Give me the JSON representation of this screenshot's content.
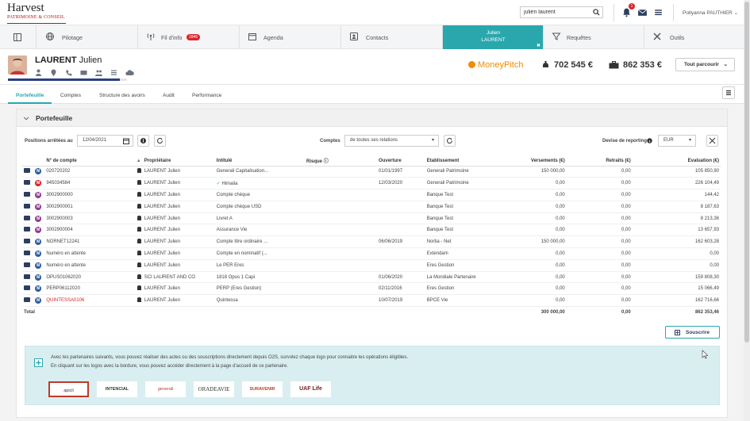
{
  "brand": {
    "line1": "Harvest",
    "line2": "PATRIMOINE & CONSEIL"
  },
  "search": {
    "value": "julien laurent"
  },
  "topbar": {
    "notif_count": "1",
    "user": "Pollyanna PAUTHIER"
  },
  "nav": {
    "items": [
      {
        "label": "Pilotage",
        "icon": "globe-icon"
      },
      {
        "label": "Fil d'info",
        "icon": "signal-icon",
        "badge": "1846"
      },
      {
        "label": "Agenda",
        "icon": "calendar-icon"
      },
      {
        "label": "Contacts",
        "icon": "contacts-icon"
      },
      {
        "label": "Julien",
        "label2": "LAURENT",
        "icon": "client-tab"
      },
      {
        "label": "Requêtes",
        "icon": "filter-icon"
      },
      {
        "label": "Outils",
        "icon": "tools-icon"
      }
    ]
  },
  "client": {
    "last": "LAURENT",
    "first": "Julien",
    "progress_pct": 94,
    "moneypitch": "MoneyPitch",
    "amount1": "702 545 €",
    "amount2": "862 353 €",
    "parcourir": "Tout parcourir"
  },
  "tabs": [
    "Portefeuille",
    "Comptes",
    "Structure des avoirs",
    "Audit",
    "Performance"
  ],
  "panel": {
    "title": "Portefeuille",
    "filters": {
      "positions_label": "Positions arrêtées au",
      "date": "12/04/2021",
      "comptes_label": "Comptes",
      "comptes_value": "de toutes ses relations",
      "devise_label": "Devise de reporting",
      "devise_value": "EUR"
    },
    "columns": [
      "N° de compte",
      "Propriétaire",
      "Intitulé",
      "Risque",
      "Ouverture",
      "Etablissement",
      "Versements (€)",
      "Retraits (€)",
      "Evaluation (€)"
    ],
    "rows": [
      {
        "badge": "M",
        "color": "#2d5d9b",
        "num": "020720202",
        "owner": "LAURENT Julien",
        "title": "Generali Capitalisation...",
        "open": "01/01/1997",
        "etab": "Generali Patrimoine",
        "vers": "150 000,00",
        "retr": "0,00",
        "eval": "105 850,90",
        "red": false
      },
      {
        "badge": "M",
        "color": "#d9262c",
        "num": "945034584",
        "owner": "LAURENT Julien",
        "title": "Himalia",
        "open": "12/03/2020",
        "etab": "Generali Patrimoine",
        "vers": "0,00",
        "retr": "0,00",
        "eval": "226 104,49",
        "red": false
      },
      {
        "badge": "M",
        "color": "#8e3b8e",
        "num": "3002900000",
        "owner": "LAURENT Julien",
        "title": "Compte chèque",
        "open": "",
        "etab": "Banque Test",
        "vers": "0,00",
        "retr": "0,00",
        "eval": "144,42",
        "red": false
      },
      {
        "badge": "M",
        "color": "#8e3b8e",
        "num": "3002900001",
        "owner": "LAURENT Julien",
        "title": "Compte chèque USD",
        "open": "",
        "etab": "Banque Test",
        "vers": "0,00",
        "retr": "0,00",
        "eval": "8 187,63",
        "red": false
      },
      {
        "badge": "M",
        "color": "#8e3b8e",
        "num": "3002900003",
        "owner": "LAURENT Julien",
        "title": "Livret A",
        "open": "",
        "etab": "Banque Test",
        "vers": "0,00",
        "retr": "0,00",
        "eval": "8 213,36",
        "red": false
      },
      {
        "badge": "M",
        "color": "#8e3b8e",
        "num": "3002900004",
        "owner": "LAURENT Julien",
        "title": "Assurance Vie",
        "open": "",
        "etab": "Banque Test",
        "vers": "0,00",
        "retr": "0,00",
        "eval": "13 657,93",
        "red": false
      },
      {
        "badge": "M",
        "color": "#2d5d9b",
        "num": "NORNET12241",
        "owner": "LAURENT Julien",
        "title": "Compte titre ordinaire ...",
        "open": "06/06/2019",
        "etab": "Nortia - Net",
        "vers": "150 000,00",
        "retr": "0,00",
        "eval": "162 603,28",
        "red": false
      },
      {
        "badge": "M",
        "color": "#2d5d9b",
        "num": "Numéro en attente",
        "owner": "LAURENT Julien",
        "title": "Compte en nominatif (...",
        "open": "",
        "etab": "Extendam",
        "vers": "0,00",
        "retr": "0,00",
        "eval": "0,00",
        "red": false
      },
      {
        "badge": "M",
        "color": "#2d5d9b",
        "num": "Numéro en attente",
        "owner": "LAURENT Julien",
        "title": "Le PER Eres",
        "open": "",
        "etab": "Eres Gestion",
        "vers": "0,00",
        "retr": "0,00",
        "eval": "0,00",
        "red": false
      },
      {
        "badge": "M",
        "color": "#2d5d9b",
        "num": "OPUS01062020",
        "owner": "SCI LAURENT AND CO",
        "title": "1818 Opus 1 Capi",
        "open": "01/06/2020",
        "etab": "La Mondiale Partenaire",
        "vers": "0,00",
        "retr": "0,00",
        "eval": "159 808,30",
        "red": false
      },
      {
        "badge": "M",
        "color": "#2d5d9b",
        "num": "PERP06112020",
        "owner": "LAURENT Julien",
        "title": "PERP (Eres Gestion)",
        "open": "02/11/2016",
        "etab": "Eres Gestion",
        "vers": "0,00",
        "retr": "0,00",
        "eval": "15 066,49",
        "red": false
      },
      {
        "badge": "M",
        "color": "#2d5d9b",
        "num": "QUINTESSA0106",
        "owner": "LAURENT Julien",
        "title": "Quintessa",
        "open": "10/07/2019",
        "etab": "BPCE Vie",
        "vers": "0,00",
        "retr": "0,00",
        "eval": "162 716,66",
        "red": true
      }
    ],
    "total": {
      "label": "Total",
      "vers": "300 000,00",
      "retr": "0,00",
      "eval": "862 353,46"
    },
    "souscrire": "Souscrire",
    "partners_text1": "Avec les partenaires suivants, vous pouvez réaliser des actes ou des souscriptions directement depuis O2S, survolez chaque logo pour connaitre les opérations éligibles.",
    "partners_text2": "En cliquant sur les logos avec la bordure, vous pouvez accéder directement à la page d'accueil de ce partenaire.",
    "partners": [
      "apicil",
      "INTENCIAL",
      "generali",
      "ORADEAVIE",
      "SURAVENIR",
      "UAF Life"
    ]
  }
}
